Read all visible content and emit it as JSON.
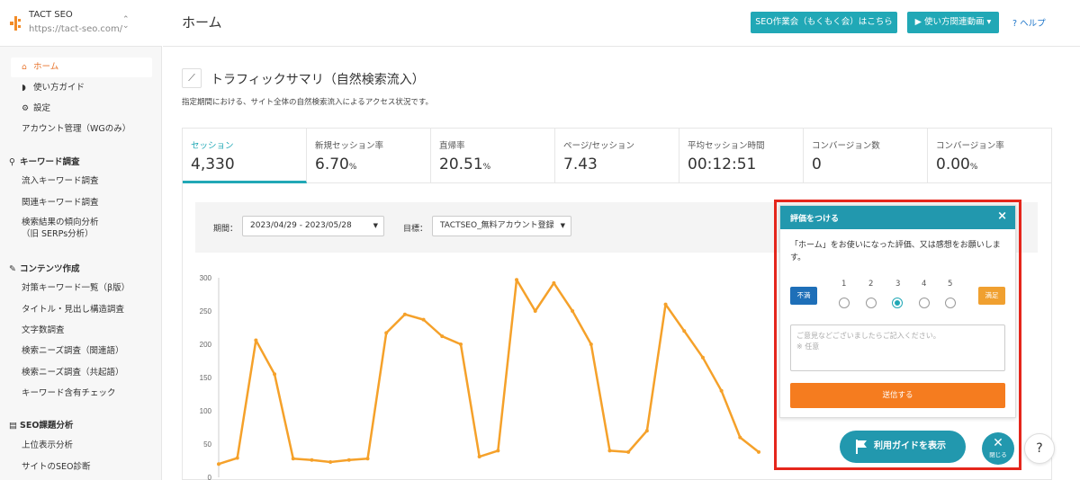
{
  "brand": {
    "name": "TACT SEO",
    "url": "https://tact-seo.com/",
    "switch_icon": "chevron-updown-icon"
  },
  "sidebar": {
    "items": [
      {
        "label": "ホーム",
        "icon": "home-icon",
        "active": true
      },
      {
        "label": "使い方ガイド",
        "icon": "shield-icon"
      },
      {
        "label": "設定",
        "icon": "gear-icon"
      },
      {
        "label": "アカウント管理（WGのみ）"
      }
    ],
    "sections": [
      {
        "title": "キーワード調査",
        "icon": "search-icon",
        "items": [
          "流入キーワード調査",
          "関連キーワード調査",
          "検索結果の傾向分析\n（旧 SERPs分析）"
        ]
      },
      {
        "title": "コンテンツ作成",
        "icon": "pencil-icon",
        "items": [
          "対策キーワード一覧（β版）",
          "タイトル・見出し構造調査",
          "文字数調査",
          "検索ニーズ調査（関連語）",
          "検索ニーズ調査（共起語）",
          "キーワード含有チェック"
        ]
      },
      {
        "title": "SEO課題分析",
        "icon": "window-icon",
        "items": [
          "上位表示分析",
          "サイトのSEO診断"
        ]
      }
    ]
  },
  "header": {
    "title": "ホーム",
    "seo_meeting_label": "SEO作業会（もくもく会）はこちら",
    "video_label": "使い方関連動画",
    "help_label": "ヘルプ"
  },
  "section": {
    "title": "トラフィックサマリ（自然検索流入）",
    "description": "指定期間における、サイト全体の自然検索流入によるアクセス状況です。",
    "icon": "line-chart-icon"
  },
  "metrics": [
    {
      "label": "セッション",
      "value": "4,330",
      "unit": "",
      "active": true
    },
    {
      "label": "新規セッション率",
      "value": "6.70",
      "unit": "%"
    },
    {
      "label": "直帰率",
      "value": "20.51",
      "unit": "%"
    },
    {
      "label": "ページ/セッション",
      "value": "7.43",
      "unit": ""
    },
    {
      "label": "平均セッション時間",
      "value": "00:12:51",
      "unit": ""
    },
    {
      "label": "コンバージョン数",
      "value": "0",
      "unit": ""
    },
    {
      "label": "コンバージョン率",
      "value": "0.00",
      "unit": "%"
    }
  ],
  "filters": {
    "period_label": "期間：",
    "period_value": "2023/04/29 - 2023/05/28",
    "goal_label": "目標：",
    "goal_value": "TACTSEO_無料アカウント登録"
  },
  "chart_data": {
    "type": "line",
    "ylim": [
      0,
      300
    ],
    "yticks": [
      0,
      50,
      100,
      150,
      200,
      250,
      300
    ],
    "grid": false,
    "color": "#f5a12a",
    "values": [
      20,
      29,
      206,
      155,
      28,
      26,
      23,
      26,
      28,
      217,
      245,
      237,
      212,
      200,
      31,
      40,
      297,
      250,
      292,
      250,
      200,
      40,
      38,
      70,
      260,
      220,
      180,
      130,
      60,
      38
    ]
  },
  "popup": {
    "title": "評価をつける",
    "message": "「ホーム」をお使いになった評価、又は感想をお願いします。",
    "bad_label": "不満",
    "good_label": "満足",
    "scale": [
      "1",
      "2",
      "3",
      "4",
      "5"
    ],
    "selected": 3,
    "placeholder_line1": "ご意見などございましたらご記入ください。",
    "placeholder_line2": "※ 任意",
    "submit_label": "送信する"
  },
  "guide_button_label": "利用ガイドを表示",
  "close_label": "閉じる",
  "help_fab_label": "?"
}
